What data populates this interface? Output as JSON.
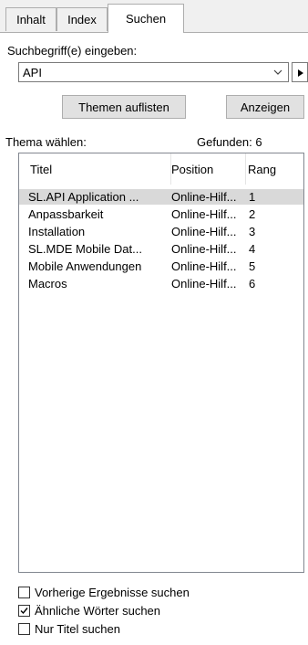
{
  "tabs": [
    {
      "label": "Inhalt",
      "active": false
    },
    {
      "label": "Index",
      "active": false
    },
    {
      "label": "Suchen",
      "active": true
    }
  ],
  "search": {
    "prompt_label": "Suchbegriff(e) eingeben:",
    "value": "API",
    "dropdown_icon": "chevron-down-icon",
    "menu_icon": "triangle-right-icon"
  },
  "buttons": {
    "list_topics": "Themen auflisten",
    "display": "Anzeigen"
  },
  "results": {
    "choose_label": "Thema wählen:",
    "found_label": "Gefunden: 6",
    "columns": [
      "Titel",
      "Position",
      "Rang"
    ],
    "rows": [
      {
        "title": "SL.API Application ...",
        "position": "Online-Hilf...",
        "rank": "1",
        "selected": true
      },
      {
        "title": "Anpassbarkeit",
        "position": "Online-Hilf...",
        "rank": "2",
        "selected": false
      },
      {
        "title": "Installation",
        "position": "Online-Hilf...",
        "rank": "3",
        "selected": false
      },
      {
        "title": "SL.MDE Mobile Dat...",
        "position": "Online-Hilf...",
        "rank": "4",
        "selected": false
      },
      {
        "title": "Mobile Anwendungen",
        "position": "Online-Hilf...",
        "rank": "5",
        "selected": false
      },
      {
        "title": "Macros",
        "position": "Online-Hilf...",
        "rank": "6",
        "selected": false
      }
    ]
  },
  "options": [
    {
      "label": "Vorherige Ergebnisse suchen",
      "checked": false
    },
    {
      "label": "Ähnliche Wörter suchen",
      "checked": true
    },
    {
      "label": "Nur Titel suchen",
      "checked": false
    }
  ],
  "colors": {
    "selected_row": "#d9d9d9",
    "border": "#adadad",
    "button_face": "#e1e1e1"
  }
}
